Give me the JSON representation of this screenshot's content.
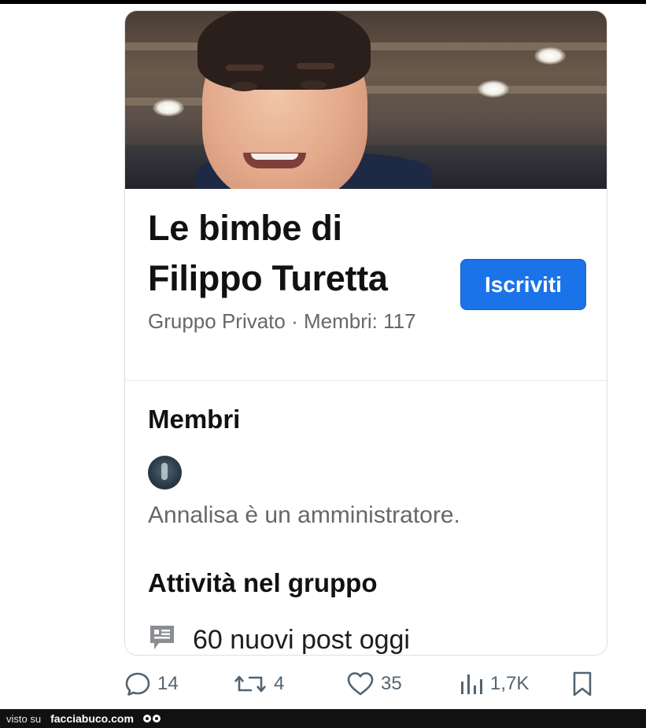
{
  "group": {
    "name": "Le bimbe di Filippo Turetta",
    "meta": "Gruppo Privato · Membri: 117",
    "join_label": "Iscriviti"
  },
  "members": {
    "heading": "Membri",
    "admin_text": "Annalisa è un amministratore."
  },
  "activity": {
    "heading": "Attività nel gruppo",
    "posts_text": "60 nuovi post oggi"
  },
  "actions": {
    "replies": "14",
    "reposts": "4",
    "likes": "35",
    "views": "1,7K"
  },
  "footer": {
    "label": "visto su",
    "site": "facciabuco.com"
  },
  "icons": {
    "reply": "reply-icon",
    "repost": "repost-icon",
    "like": "heart-icon",
    "views": "views-icon",
    "bookmark": "bookmark-icon",
    "posts": "post-icon"
  },
  "colors": {
    "accent": "#1a73e8",
    "secondary_text": "#65676b",
    "action_gray": "#536471"
  }
}
